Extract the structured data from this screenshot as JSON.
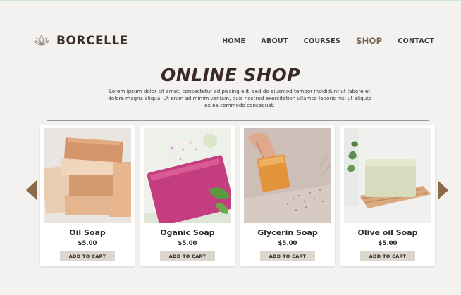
{
  "brand": {
    "name": "BORCELLE",
    "logo_icon": "lotus-icon"
  },
  "nav": {
    "items": [
      {
        "label": "HOME",
        "active": false
      },
      {
        "label": "ABOUT",
        "active": false
      },
      {
        "label": "COURSES",
        "active": false
      },
      {
        "label": "SHOP",
        "active": true
      },
      {
        "label": "CONTACT",
        "active": false
      }
    ]
  },
  "hero": {
    "title": "ONLINE SHOP",
    "intro": "Lorem ipsum dolor sit amet, consectetur adipiscing elit, sed do eiusmod tempor incididunt ut labore et dolore magna aliqua. Ut enim ad minim veniam, quis nostrud exercitation ullamco laboris nisi ut aliquip ex ea commodo consequat."
  },
  "carousel": {
    "prev_icon": "chevron-left-icon",
    "next_icon": "chevron-right-icon",
    "products": [
      {
        "name": "Oil Soap",
        "price": "$5.00",
        "button": "ADD TO CART",
        "image_icon": "oil-soap-image"
      },
      {
        "name": "Oganic Soap",
        "price": "$5.00",
        "button": "ADD TO CART",
        "image_icon": "organic-soap-image"
      },
      {
        "name": "Glycerin Soap",
        "price": "$5.00",
        "button": "ADD TO CART",
        "image_icon": "glycerin-soap-image"
      },
      {
        "name": "Olive oil Soap",
        "price": "$5.00",
        "button": "ADD TO CART",
        "image_icon": "olive-oil-soap-image"
      }
    ]
  },
  "colors": {
    "background": "#f3f2f0",
    "accent": "#8a6a4a",
    "button": "#ddd6cf",
    "text_dark": "#3a2a27"
  }
}
